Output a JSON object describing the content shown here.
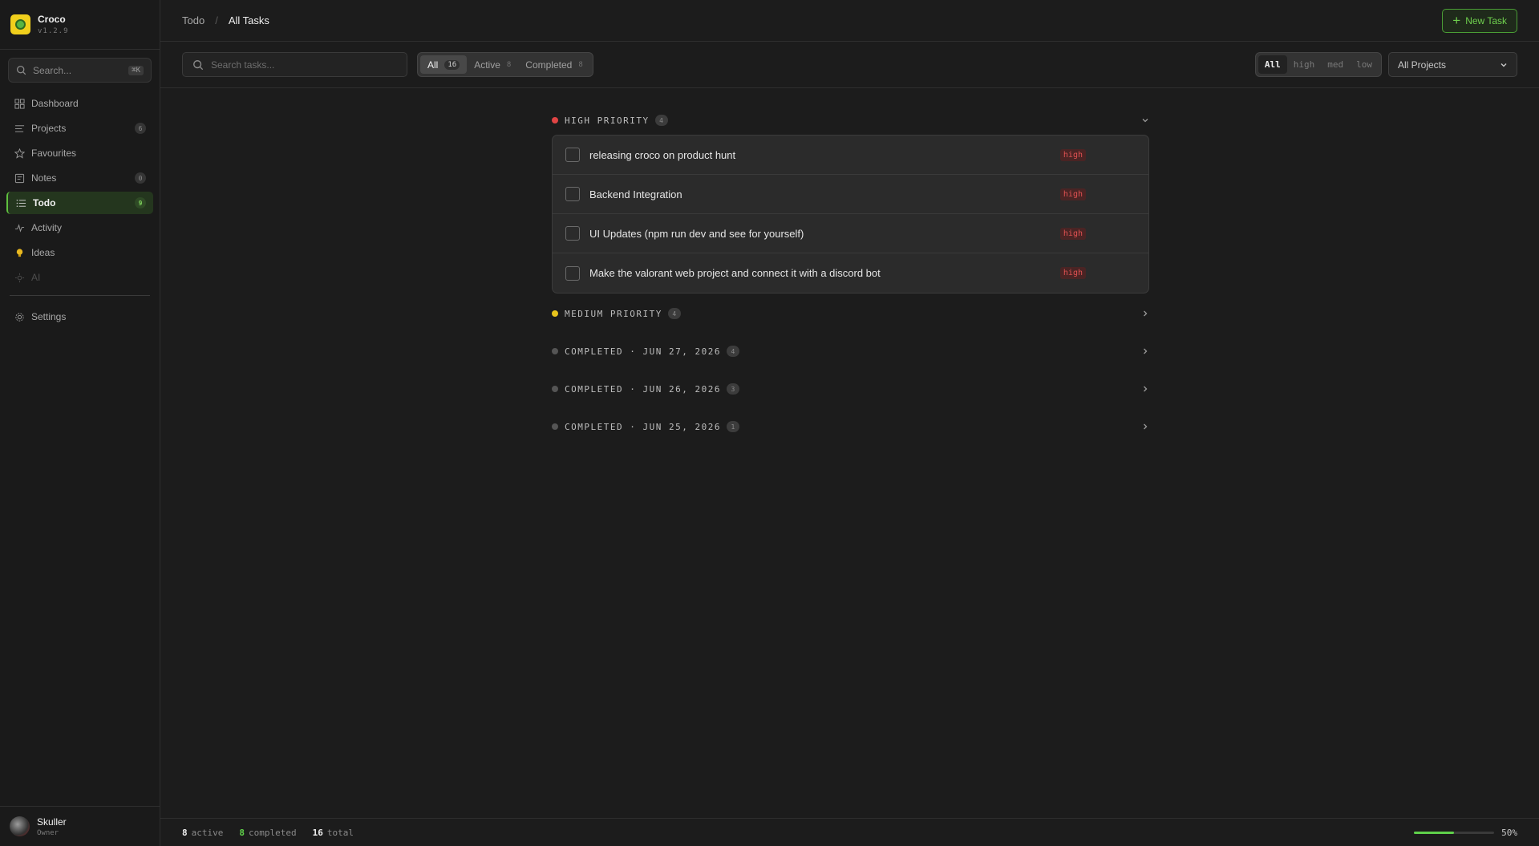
{
  "brand": {
    "name": "Croco",
    "version": "v1.2.9"
  },
  "sidebar": {
    "search": {
      "placeholder": "Search...",
      "shortcut": "⌘K"
    },
    "items": [
      {
        "label": "Dashboard",
        "icon": "grid-icon",
        "count": ""
      },
      {
        "label": "Projects",
        "icon": "list-icon",
        "count": "6"
      },
      {
        "label": "Favourites",
        "icon": "star-icon",
        "count": ""
      },
      {
        "label": "Notes",
        "icon": "note-icon",
        "count": "0"
      },
      {
        "label": "Todo",
        "icon": "checklist-icon",
        "count": "9",
        "active": true
      },
      {
        "label": "Activity",
        "icon": "pulse-icon",
        "count": ""
      },
      {
        "label": "Ideas",
        "icon": "lightbulb-icon",
        "count": ""
      },
      {
        "label": "AI",
        "icon": "sparkle-icon",
        "count": "",
        "disabled": true
      }
    ],
    "settings": {
      "label": "Settings",
      "icon": "gear-icon"
    },
    "user": {
      "name": "Skuller",
      "role": "Owner"
    }
  },
  "header": {
    "breadcrumb": [
      "Todo",
      "All Tasks"
    ],
    "new_task_label": "New Task"
  },
  "filters": {
    "search_placeholder": "Search tasks...",
    "status_tabs": [
      {
        "label": "All",
        "count": "16",
        "active": true
      },
      {
        "label": "Active",
        "count": "8"
      },
      {
        "label": "Completed",
        "count": "8"
      }
    ],
    "priority": [
      {
        "label": "All",
        "active": true
      },
      {
        "label": "high"
      },
      {
        "label": "med"
      },
      {
        "label": "low"
      }
    ],
    "project_select": "All Projects"
  },
  "groups": [
    {
      "title": "HIGH PRIORITY",
      "count": "4",
      "color": "#e04444",
      "expanded": true,
      "tasks": [
        {
          "text": "releasing croco on product hunt",
          "priority": "high"
        },
        {
          "text": "Backend Integration",
          "priority": "high"
        },
        {
          "text": "UI Updates (npm run dev and see for yourself)",
          "priority": "high"
        },
        {
          "text": "Make the valorant web project and connect it with a discord bot",
          "priority": "high"
        }
      ]
    },
    {
      "title": "MEDIUM PRIORITY",
      "count": "4",
      "color": "#e8c41c",
      "expanded": false
    },
    {
      "title": "COMPLETED · JUN 27, 2026",
      "count": "4",
      "color": "#555555",
      "expanded": false
    },
    {
      "title": "COMPLETED · JUN 26, 2026",
      "count": "3",
      "color": "#555555",
      "expanded": false
    },
    {
      "title": "COMPLETED · JUN 25, 2026",
      "count": "1",
      "color": "#555555",
      "expanded": false
    }
  ],
  "status": {
    "active": "8",
    "active_label": "active",
    "completed": "8",
    "completed_label": "completed",
    "total": "16",
    "total_label": "total",
    "progress": 0.5,
    "progress_label": "50%"
  },
  "colors": {
    "accent": "#5fd04a",
    "background": "#1c1c1c",
    "high": "#e05252"
  }
}
